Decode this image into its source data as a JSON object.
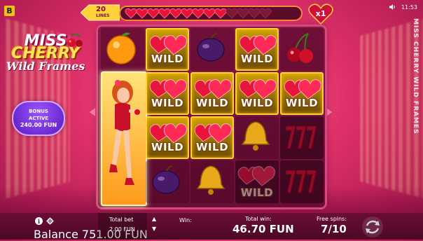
{
  "app": {
    "brand_badge": "B",
    "vertical_title": "MISS CHERRY WILD FRAMES",
    "status_time": "11:53"
  },
  "logo": {
    "line1": "MISS",
    "line2": "CHERRY",
    "line3": "Wild Frames"
  },
  "bonus": {
    "line1": "BONUS",
    "line2": "ACTIVE",
    "amount": "240.00 FUN"
  },
  "lines": {
    "count": "20",
    "label": "LINES"
  },
  "hearts": {
    "filled": 9,
    "total": 13
  },
  "multiplier": "x1",
  "reels": {
    "wild_label": "WILD",
    "grid": [
      [
        "orange",
        "lady",
        "lady",
        "lady"
      ],
      [
        "wild",
        "wild",
        "wild",
        "plum"
      ],
      [
        "plum",
        "wild",
        "wild",
        "bell"
      ],
      [
        "wild",
        "wild",
        "bell",
        "wild"
      ],
      [
        "cherry",
        "wild",
        "sevens",
        "sevens"
      ]
    ]
  },
  "bottom": {
    "balance_label": "Balance",
    "balance_value": "751.00 FUN",
    "total_bet_label": "Total bet",
    "total_bet_value": "2.00 FUN",
    "win_label": "Win:",
    "total_win_label": "Total win:",
    "total_win_value": "46.70 FUN",
    "free_spins_label": "Free spins:",
    "free_spins_value": "7/10"
  },
  "colors": {
    "background": "#e0306a",
    "reel_frame": "#d6487f",
    "win_border": "#ffd23a",
    "bonus": "#6a2ad0"
  }
}
